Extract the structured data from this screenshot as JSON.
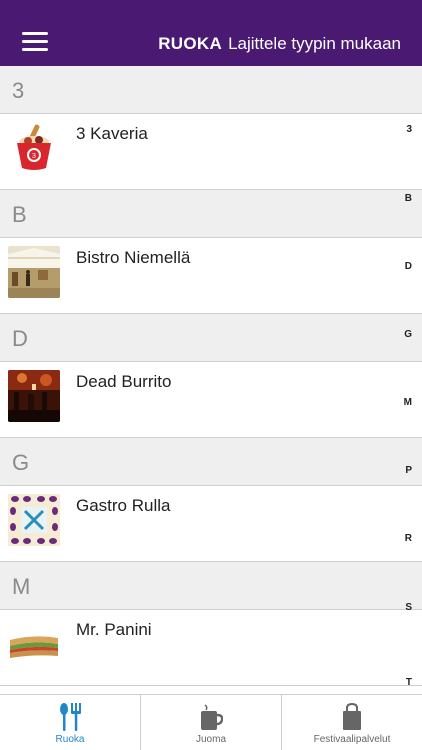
{
  "header": {
    "title_bold": "RUOKA",
    "title_rest": "Lajittele tyypin mukaan"
  },
  "sections": [
    {
      "letter": "3",
      "items": [
        {
          "name": "3 Kaveria",
          "thumb": "ice-cream-cup-thumbnail"
        }
      ]
    },
    {
      "letter": "B",
      "items": [
        {
          "name": "Bistro Niemellä",
          "thumb": "festival-tent-thumbnail"
        }
      ]
    },
    {
      "letter": "D",
      "items": [
        {
          "name": "Dead Burrito",
          "thumb": "night-crowd-thumbnail"
        }
      ]
    },
    {
      "letter": "G",
      "items": [
        {
          "name": "Gastro Rulla",
          "thumb": "fork-knife-pattern-thumbnail"
        }
      ]
    },
    {
      "letter": "M",
      "items": [
        {
          "name": "Mr. Panini",
          "thumb": "sandwich-thumbnail"
        }
      ]
    }
  ],
  "index_letters": [
    "3",
    "B",
    "D",
    "G",
    "M",
    "P",
    "R",
    "S",
    "T"
  ],
  "tabs": [
    {
      "label": "Ruoka",
      "icon": "fork-spoon-icon",
      "active": true
    },
    {
      "label": "Juoma",
      "icon": "cup-icon",
      "active": false
    },
    {
      "label": "Festivaalipalvelut",
      "icon": "shopping-bag-icon",
      "active": false
    }
  ],
  "colors": {
    "header_bg": "#4a1a73",
    "active_tab": "#1f87c9",
    "section_bg": "#efefef"
  }
}
